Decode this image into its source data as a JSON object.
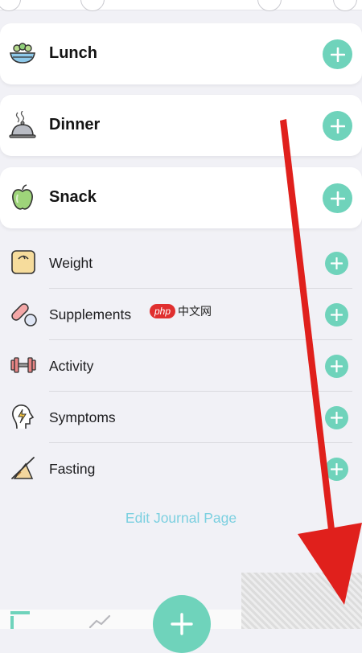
{
  "meals": [
    {
      "label": "Lunch",
      "icon": "salad-bowl-icon"
    },
    {
      "label": "Dinner",
      "icon": "cloche-icon"
    },
    {
      "label": "Snack",
      "icon": "apple-icon"
    }
  ],
  "trackers": [
    {
      "label": "Weight",
      "icon": "scale-icon"
    },
    {
      "label": "Supplements",
      "icon": "pills-icon"
    },
    {
      "label": "Activity",
      "icon": "dumbbell-icon"
    },
    {
      "label": "Symptoms",
      "icon": "head-lightning-icon"
    },
    {
      "label": "Fasting",
      "icon": "fasting-icon"
    }
  ],
  "edit_link": "Edit Journal Page",
  "watermark": {
    "badge": "php",
    "text": "中文网"
  },
  "colors": {
    "accent": "#6fd3bb",
    "link": "#7cd0e0",
    "annotation_arrow": "#e0201c"
  }
}
